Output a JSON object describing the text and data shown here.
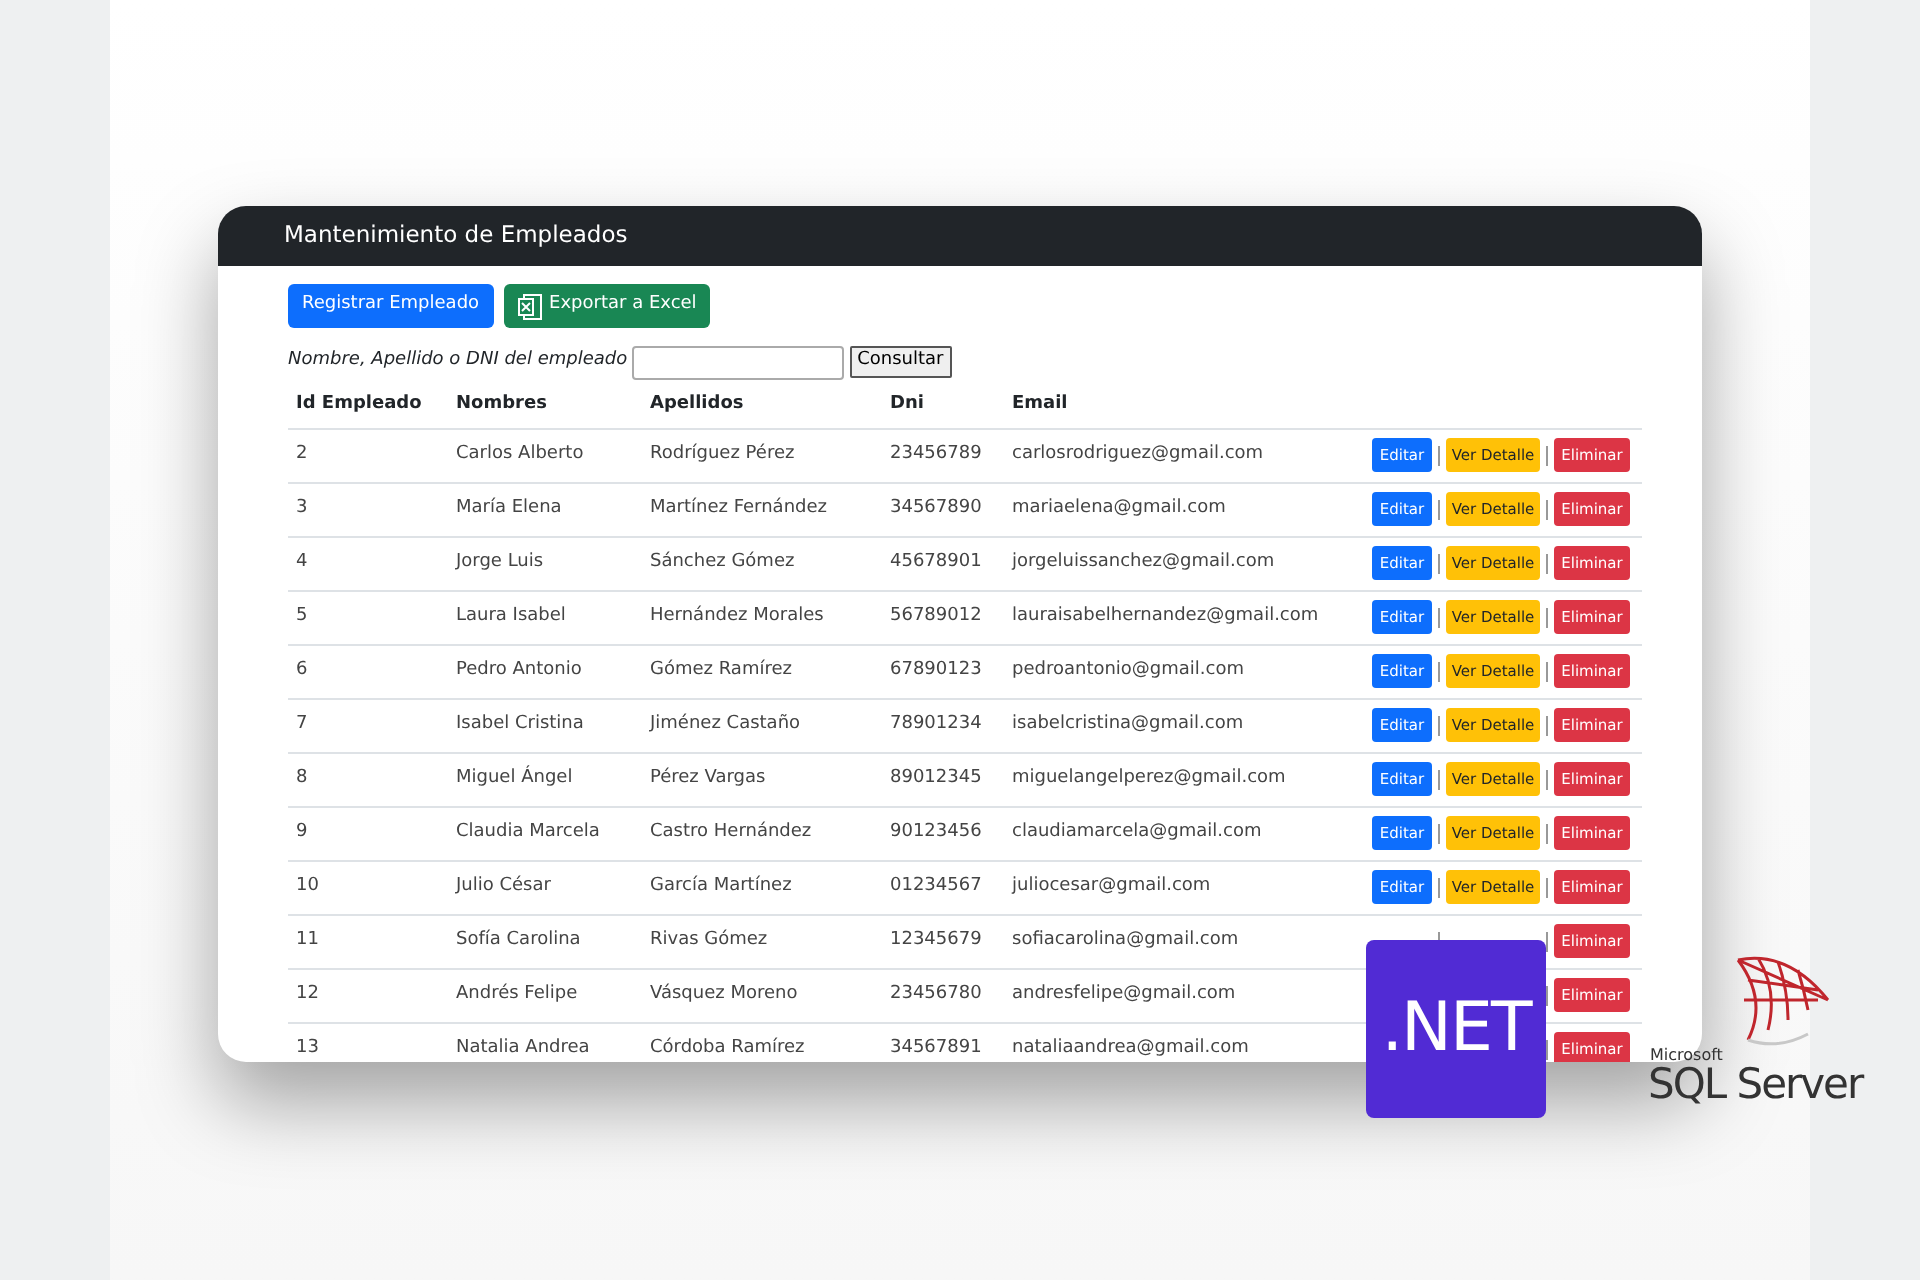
{
  "card": {
    "title": "Mantenimiento de Empleados"
  },
  "buttons": [
    {
      "label": "Registrar Empleado",
      "kind": "primary"
    },
    {
      "label": "Exportar a Excel",
      "kind": "excel"
    }
  ],
  "search": {
    "label": "Nombre, Apellido o DNI del empleado",
    "button": "Consultar"
  },
  "table": {
    "columns": [
      "Id Empleado",
      "Nombres",
      "Apellidos",
      "Dni",
      "Email"
    ],
    "rows": [
      {
        "cells": [
          "2",
          "Carlos Alberto",
          "Rodríguez Pérez",
          "23456789",
          "carlosrodriguez@gmail.com"
        ],
        "actions": [
          {
            "label": "Editar",
            "kind": "edit"
          },
          {
            "label": "Ver Detalle",
            "kind": "view"
          },
          {
            "label": "Eliminar",
            "kind": "delete"
          }
        ]
      },
      {
        "cells": [
          "3",
          "María Elena",
          "Martínez Fernández",
          "34567890",
          "mariaelena@gmail.com"
        ],
        "actions": [
          {
            "label": "Editar",
            "kind": "edit"
          },
          {
            "label": "Ver Detalle",
            "kind": "view"
          },
          {
            "label": "Eliminar",
            "kind": "delete"
          }
        ]
      },
      {
        "cells": [
          "4",
          "Jorge Luis",
          "Sánchez Gómez",
          "45678901",
          "jorgeluissanchez@gmail.com"
        ],
        "actions": [
          {
            "label": "Editar",
            "kind": "edit"
          },
          {
            "label": "Ver Detalle",
            "kind": "view"
          },
          {
            "label": "Eliminar",
            "kind": "delete"
          }
        ]
      },
      {
        "cells": [
          "5",
          "Laura Isabel",
          "Hernández Morales",
          "56789012",
          "lauraisabelhernandez@gmail.com"
        ],
        "actions": [
          {
            "label": "Editar",
            "kind": "edit"
          },
          {
            "label": "Ver Detalle",
            "kind": "view"
          },
          {
            "label": "Eliminar",
            "kind": "delete"
          }
        ]
      },
      {
        "cells": [
          "6",
          "Pedro Antonio",
          "Gómez Ramírez",
          "67890123",
          "pedroantonio@gmail.com"
        ],
        "actions": [
          {
            "label": "Editar",
            "kind": "edit"
          },
          {
            "label": "Ver Detalle",
            "kind": "view"
          },
          {
            "label": "Eliminar",
            "kind": "delete"
          }
        ]
      },
      {
        "cells": [
          "7",
          "Isabel Cristina",
          "Jiménez Castaño",
          "78901234",
          "isabelcristina@gmail.com"
        ],
        "actions": [
          {
            "label": "Editar",
            "kind": "edit"
          },
          {
            "label": "Ver Detalle",
            "kind": "view"
          },
          {
            "label": "Eliminar",
            "kind": "delete"
          }
        ]
      },
      {
        "cells": [
          "8",
          "Miguel Ángel",
          "Pérez Vargas",
          "89012345",
          "miguelangelperez@gmail.com"
        ],
        "actions": [
          {
            "label": "Editar",
            "kind": "edit"
          },
          {
            "label": "Ver Detalle",
            "kind": "view"
          },
          {
            "label": "Eliminar",
            "kind": "delete"
          }
        ]
      },
      {
        "cells": [
          "9",
          "Claudia Marcela",
          "Castro Hernández",
          "90123456",
          "claudiamarcela@gmail.com"
        ],
        "actions": [
          {
            "label": "Editar",
            "kind": "edit"
          },
          {
            "label": "Ver Detalle",
            "kind": "view"
          },
          {
            "label": "Eliminar",
            "kind": "delete"
          }
        ]
      },
      {
        "cells": [
          "10",
          "Julio César",
          "García Martínez",
          "01234567",
          "juliocesar@gmail.com"
        ],
        "actions": [
          {
            "label": "Editar",
            "kind": "edit"
          },
          {
            "label": "Ver Detalle",
            "kind": "view"
          },
          {
            "label": "Eliminar",
            "kind": "delete"
          }
        ]
      },
      {
        "cells": [
          "11",
          "Sofía Carolina",
          "Rivas Gómez",
          "12345679",
          "sofiacarolina@gmail.com"
        ],
        "actions": [
          {
            "label": "Eliminar",
            "kind": "delete"
          }
        ]
      },
      {
        "cells": [
          "12",
          "Andrés Felipe",
          "Vásquez Moreno",
          "23456780",
          "andresfelipe@gmail.com"
        ],
        "actions": [
          {
            "label": "Eliminar",
            "kind": "delete"
          }
        ]
      },
      {
        "cells": [
          "13",
          "Natalia Andrea",
          "Córdoba Ramírez",
          "34567891",
          "nataliaandrea@gmail.com"
        ],
        "actions": [
          {
            "label": "Eliminar",
            "kind": "delete"
          }
        ]
      }
    ]
  },
  "logos": {
    "dotnet": ".NET",
    "sql_vendor": "Microsoft",
    "sql_product": "SQL Server"
  }
}
